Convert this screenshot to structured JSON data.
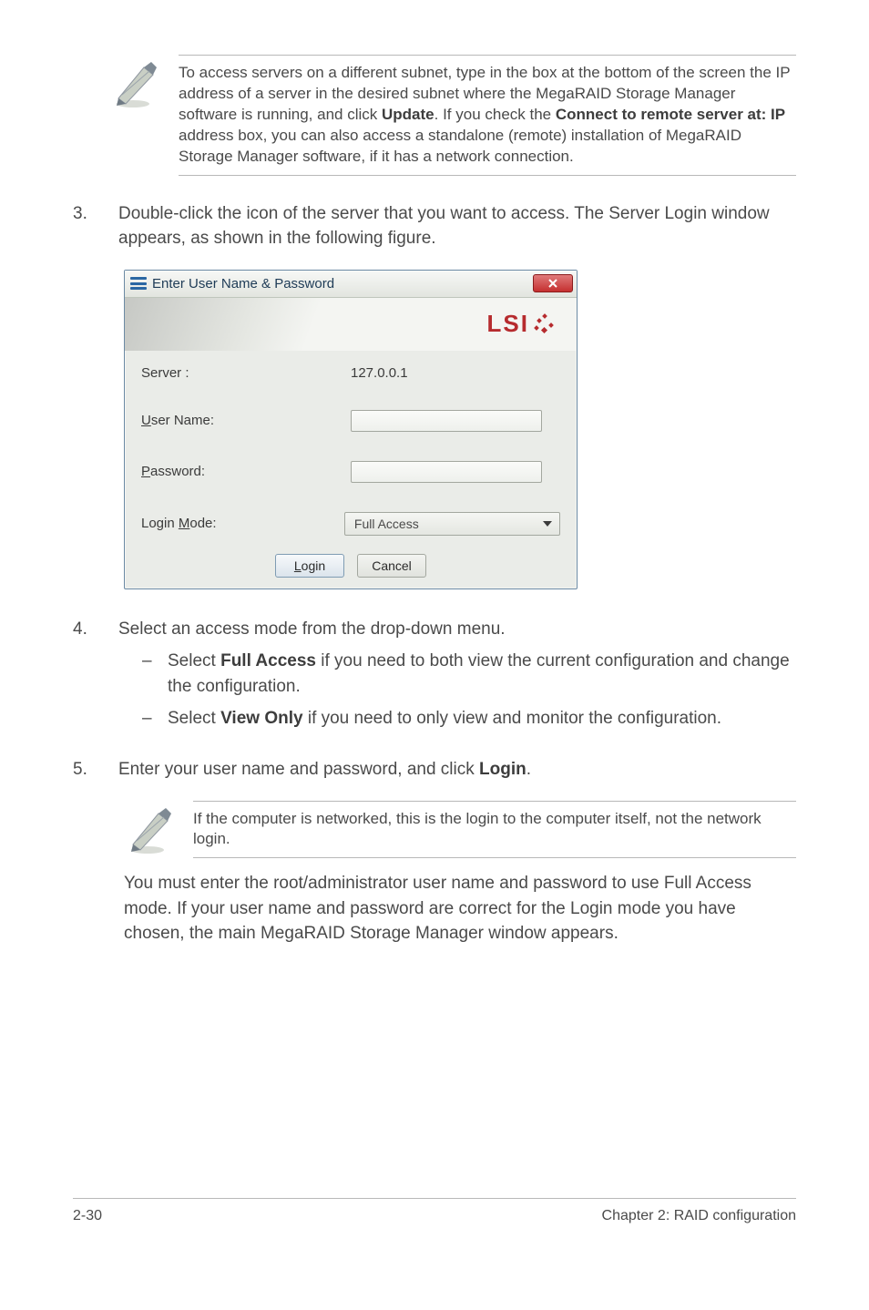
{
  "note1": {
    "text_parts": [
      "To access servers on a different subnet, type in the box at the bottom of the screen the IP address of a server in the desired subnet where the MegaRAID Storage Manager software is running, and click ",
      ". If you check the ",
      " address box, you can also access a standalone (remote) installation of MegaRAID Storage Manager software, if it has a network connection."
    ],
    "bold1": "Update",
    "bold2": "Connect to remote server at: IP"
  },
  "step3": {
    "num": "3.",
    "text": "Double-click the icon of the server that you want to access. The Server Login window appears, as shown in the following figure."
  },
  "dialog": {
    "title": "Enter User Name & Password",
    "close": "x",
    "logo": "LSI",
    "fields": {
      "server_label": "Server :",
      "server_value": "127.0.0.1",
      "username_label_pre": "U",
      "username_label_rest": "ser Name:",
      "password_label_pre": "P",
      "password_label_rest": "assword:",
      "loginmode_label_pre": "Login ",
      "loginmode_label_ul": "M",
      "loginmode_label_post": "ode:",
      "loginmode_value": "Full Access"
    },
    "buttons": {
      "login_ul": "L",
      "login_rest": "ogin",
      "cancel": "Cancel"
    }
  },
  "step4": {
    "num": "4.",
    "text": "Select an access mode from the drop-down menu.",
    "bullet1_pre": "Select ",
    "bullet1_bold": "Full Access",
    "bullet1_post": " if you need to both view the current configuration and change the configuration.",
    "bullet2_pre": "Select ",
    "bullet2_bold": "View Only",
    "bullet2_post": " if you need to only view and monitor the configuration."
  },
  "step5": {
    "num": "5.",
    "text_pre": "Enter your user name and password, and click ",
    "text_bold": "Login",
    "text_post": "."
  },
  "note2": {
    "text": "If the computer is networked, this is the login to the computer itself, not the network login."
  },
  "after": "You must enter the root/administrator user name and password to use Full Access mode. If your user name and password are correct for the Login mode you have chosen, the main MegaRAID Storage Manager window appears.",
  "footer": {
    "left": "2-30",
    "right": "Chapter 2: RAID configuration"
  }
}
